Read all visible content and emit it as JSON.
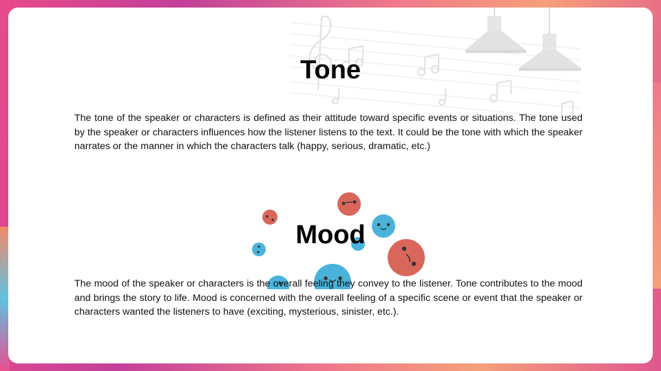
{
  "slide": {
    "tone": {
      "heading": "Tone",
      "body": "The tone of the speaker or characters is defined as their attitude toward specific events or situations. The tone used by the speaker or characters influences how the listener listens to the text. It could be the tone with which the speaker narrates or the manner in which the characters talk (happy, serious, dramatic, etc.)"
    },
    "mood": {
      "heading": "Mood",
      "body": "The mood of the speaker or characters is the overall feeling they convey to the listener. Tone contributes to the mood and brings the story to life. Mood is concerned with the overall feeling of a specific scene or event that the speaker or characters wanted the listeners to have (exciting, mysterious, sinister, etc.)."
    }
  },
  "colors": {
    "face_red": "#d9665a",
    "face_blue": "#4ab3dc",
    "deco_gray": "#e6e6e6"
  },
  "icons": [
    "music-staff-icon",
    "pendant-lamp-icon",
    "emoji-face-icon"
  ]
}
